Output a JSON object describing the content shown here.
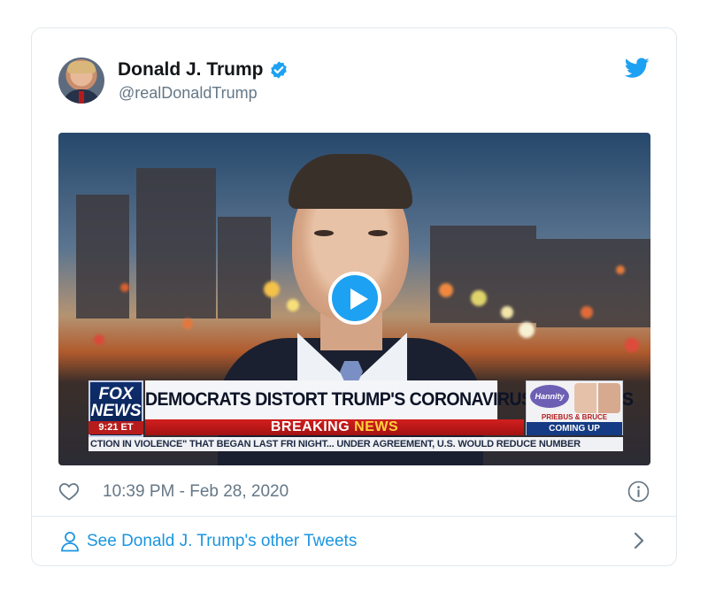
{
  "tweet": {
    "author_name": "Donald J. Trump",
    "handle": "@realDonaldTrump",
    "timestamp": "10:39 PM - Feb 28, 2020",
    "other_tweets_link": "See Donald J. Trump's other Tweets"
  },
  "video": {
    "network_logo_line1": "FOX",
    "network_logo_line2": "NEWS",
    "network_time": "9:21 ET",
    "headline": "DEMOCRATS DISTORT TRUMP'S CORONAVIRUS READINESS",
    "breaking_word1": "BREAKING",
    "breaking_word2": "NEWS",
    "promo_show": "Hannity",
    "promo_names": "PRIEBUS & BRUCE",
    "promo_coming_up": "COMING UP",
    "ticker": "CTION IN VIOLENCE\" THAT BEGAN LAST FRI NIGHT...   UNDER AGREEMENT, U.S. WOULD REDUCE NUMBER"
  },
  "icons": {
    "verified": "verified-badge-icon",
    "platform": "twitter-bird-icon",
    "play": "play-icon",
    "like": "heart-icon",
    "info": "info-icon",
    "profile": "person-icon",
    "next": "chevron-right-icon"
  },
  "colors": {
    "accent": "#1da1f2",
    "link": "#1b95e0",
    "muted_text": "#657786",
    "border": "#e1e8ed"
  }
}
